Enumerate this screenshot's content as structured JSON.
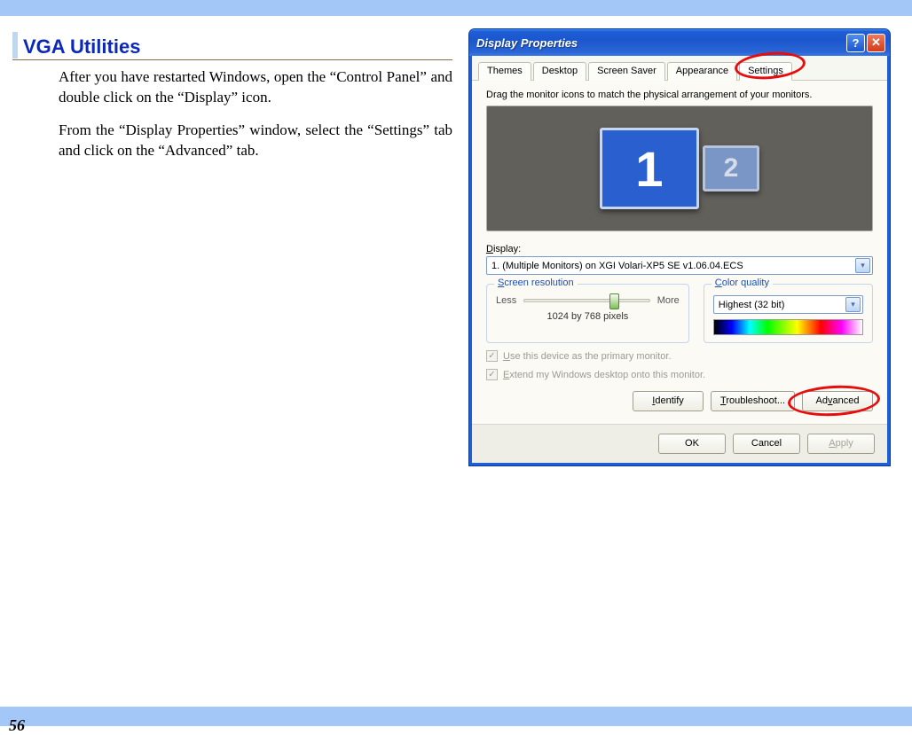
{
  "page": {
    "number": "56",
    "heading": "VGA Utilities",
    "paragraph1": "After you have restarted Windows, open the “Control Panel” and double click on the “Display” icon.",
    "paragraph2": "From the “Display Properties” window, select the “Settings” tab and click on the “Advanced” tab."
  },
  "dialog": {
    "title": "Display Properties",
    "help_label": "?",
    "close_label": "✕",
    "tabs": {
      "themes": "Themes",
      "desktop": "Desktop",
      "screensaver": "Screen Saver",
      "appearance": "Appearance",
      "settings": "Settings"
    },
    "instruction": "Drag the monitor icons to match the physical arrangement of your monitors.",
    "monitor1": "1",
    "monitor2": "2",
    "display_label": "Display:",
    "display_value": "1. (Multiple Monitors) on XGI Volari-XP5 SE  v1.06.04.ECS",
    "screen_res": {
      "title": "Screen resolution",
      "less": "Less",
      "more": "More",
      "value": "1024 by 768 pixels"
    },
    "color_quality": {
      "title": "Color quality",
      "value": "Highest (32 bit)"
    },
    "chk_primary": "Use this device as the primary monitor.",
    "chk_extend": "Extend my Windows desktop onto this monitor.",
    "buttons": {
      "identify": "Identify",
      "troubleshoot": "Troubleshoot...",
      "advanced": "Advanced",
      "ok": "OK",
      "cancel": "Cancel",
      "apply": "Apply"
    }
  }
}
